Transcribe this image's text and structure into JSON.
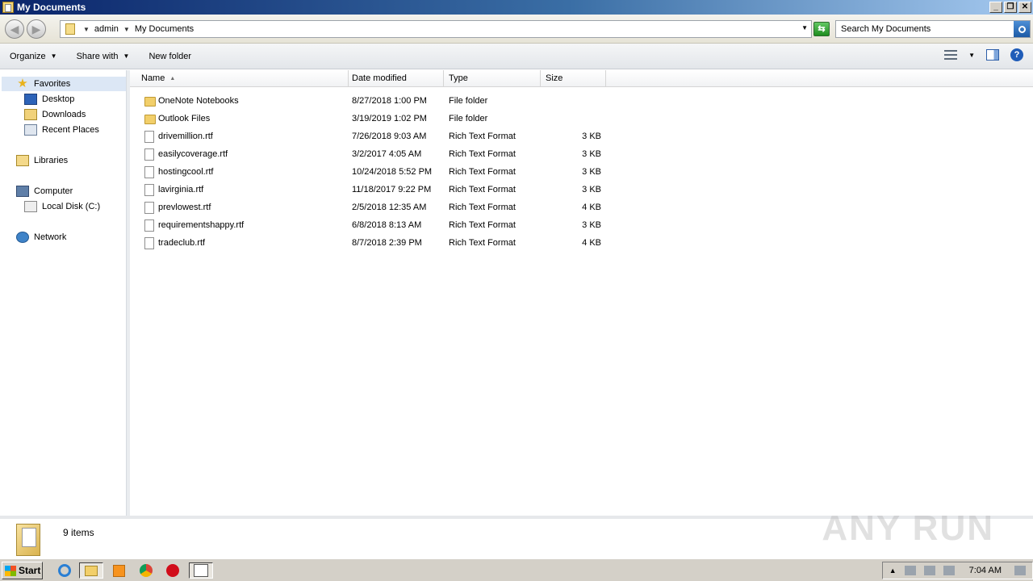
{
  "window": {
    "title": "My Documents",
    "controls": {
      "minimize": "_",
      "restore": "❐",
      "close": "✕"
    }
  },
  "address": {
    "crumbs": [
      "admin",
      "My Documents"
    ],
    "search_placeholder": "Search My Documents"
  },
  "toolbar": {
    "organize": "Organize",
    "share_with": "Share with",
    "new_folder": "New folder"
  },
  "nav": {
    "favorites": "Favorites",
    "desktop": "Desktop",
    "downloads": "Downloads",
    "recent": "Recent Places",
    "libraries": "Libraries",
    "computer": "Computer",
    "local_disk": "Local Disk (C:)",
    "network": "Network"
  },
  "columns": {
    "name": "Name",
    "date": "Date modified",
    "type": "Type",
    "size": "Size"
  },
  "files": [
    {
      "name": "OneNote Notebooks",
      "date": "8/27/2018 1:00 PM",
      "type": "File folder",
      "size": "",
      "kind": "folder"
    },
    {
      "name": "Outlook Files",
      "date": "3/19/2019 1:02 PM",
      "type": "File folder",
      "size": "",
      "kind": "folder"
    },
    {
      "name": "drivemillion.rtf",
      "date": "7/26/2018 9:03 AM",
      "type": "Rich Text Format",
      "size": "3 KB",
      "kind": "doc"
    },
    {
      "name": "easilycoverage.rtf",
      "date": "3/2/2017 4:05 AM",
      "type": "Rich Text Format",
      "size": "3 KB",
      "kind": "doc"
    },
    {
      "name": "hostingcool.rtf",
      "date": "10/24/2018 5:52 PM",
      "type": "Rich Text Format",
      "size": "3 KB",
      "kind": "doc"
    },
    {
      "name": "lavirginia.rtf",
      "date": "11/18/2017 9:22 PM",
      "type": "Rich Text Format",
      "size": "3 KB",
      "kind": "doc"
    },
    {
      "name": "prevlowest.rtf",
      "date": "2/5/2018 12:35 AM",
      "type": "Rich Text Format",
      "size": "4 KB",
      "kind": "doc"
    },
    {
      "name": "requirementshappy.rtf",
      "date": "6/8/2018 8:13 AM",
      "type": "Rich Text Format",
      "size": "3 KB",
      "kind": "doc"
    },
    {
      "name": "tradeclub.rtf",
      "date": "8/7/2018 2:39 PM",
      "type": "Rich Text Format",
      "size": "4 KB",
      "kind": "doc"
    }
  ],
  "status": {
    "count": "9 items"
  },
  "watermark": "ANY RUN",
  "taskbar": {
    "start": "Start",
    "clock": "7:04 AM"
  }
}
